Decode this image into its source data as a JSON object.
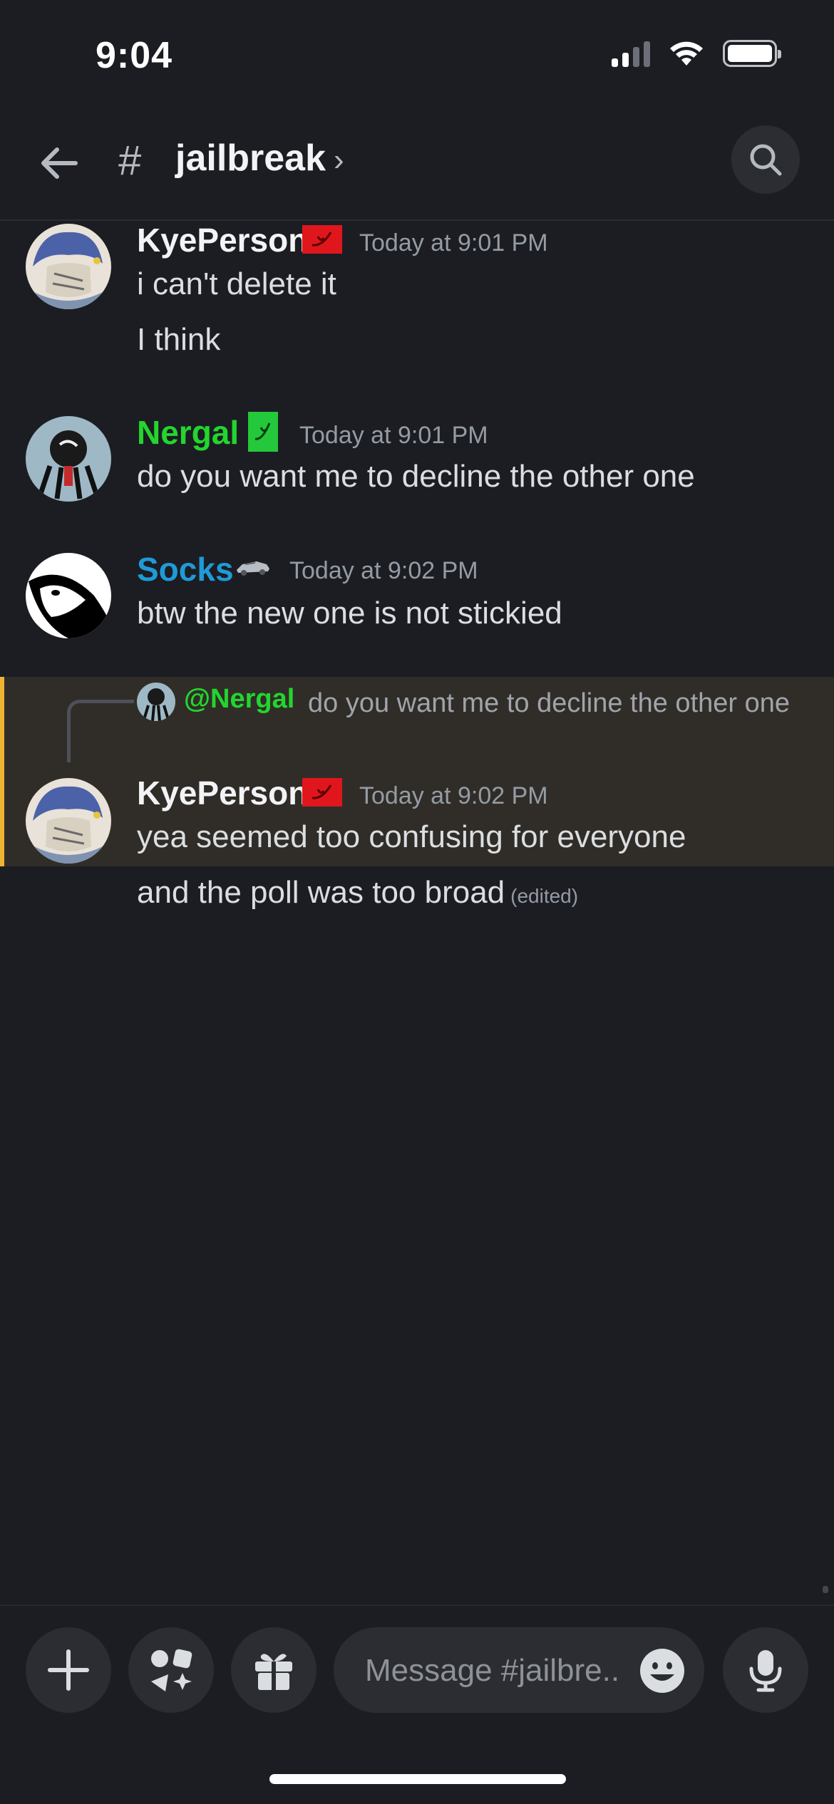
{
  "status_bar": {
    "time": "9:04",
    "signal_bars": 2,
    "wifi": "wifi-icon",
    "battery_icon": "battery-icon"
  },
  "header": {
    "back_icon": "arrow-left-icon",
    "channel_prefix": "#",
    "channel_name": "jailbreak",
    "chevron": "›",
    "search_icon": "search-icon"
  },
  "messages": [
    {
      "author": "KyePerson",
      "author_color": "#f2f3f5",
      "timestamp": "Today at 9:01 PM",
      "lines": [
        "i can't delete it",
        "I think"
      ]
    },
    {
      "author": "Nergal",
      "author_color": "#23d52e",
      "timestamp": "Today at 9:01 PM",
      "lines": [
        "do you want me to decline the other one"
      ]
    },
    {
      "author": "Socks",
      "author_color": "#1e9bd7",
      "timestamp": "Today at 9:02 PM",
      "lines": [
        "btw the new one is not stickied"
      ]
    },
    {
      "reply_to": {
        "mention": "@Nergal",
        "text": "do you want me to decline the other one"
      },
      "author": "KyePerson",
      "author_color": "#f2f3f5",
      "timestamp": "Today at 9:02 PM",
      "lines": [
        "yea seemed too confusing for everyone",
        "and the poll was too broad"
      ],
      "edited_label": "(edited)"
    }
  ],
  "composer": {
    "add_icon": "plus-icon",
    "apps_icon": "apps-icon",
    "gift_icon": "gift-icon",
    "placeholder": "Message #jailbre..",
    "emoji_icon": "emoji-icon",
    "mic_icon": "microphone-icon"
  },
  "colors": {
    "background": "#1c1d23",
    "mention_highlight": "#302d28",
    "highlight_bar": "#f0b232"
  }
}
